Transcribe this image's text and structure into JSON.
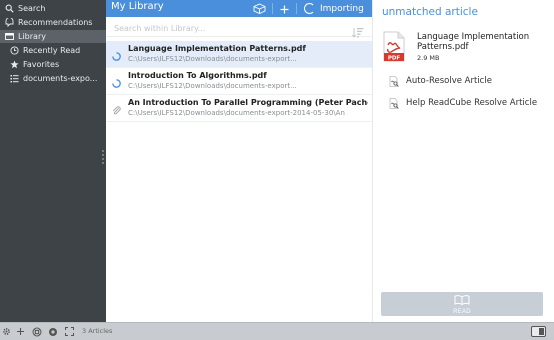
{
  "sidebar": {
    "items": [
      {
        "label": "Search",
        "icon": "search-icon"
      },
      {
        "label": "Recommendations",
        "icon": "recommendations-icon"
      },
      {
        "label": "Library",
        "icon": "library-icon",
        "active": true
      },
      {
        "label": "Recently Read",
        "icon": "clock-icon"
      },
      {
        "label": "Favorites",
        "icon": "star-icon"
      },
      {
        "label": "documents-expo...",
        "icon": "list-icon"
      }
    ]
  },
  "header": {
    "title": "My Library",
    "import_label": "Importing"
  },
  "search": {
    "placeholder": "Search within Library..."
  },
  "articles": [
    {
      "title": "Language Implementation Patterns.pdf",
      "path": "C:\\Users\\ILFS12\\Downloads\\documents-export...",
      "status": "loading",
      "selected": true
    },
    {
      "title": "Introduction To Algorithms.pdf",
      "path": "C:\\Users\\ILFS12\\Downloads\\documents-export...",
      "status": "loading",
      "selected": false
    },
    {
      "title": "An Introduction To Parallel Programming (Peter Pachec...",
      "path": "C:\\Users\\ILFS12\\Downloads\\documents-export-2014-05-30\\An ...",
      "status": "attachment",
      "selected": false
    }
  ],
  "detail": {
    "heading": "unmatched article",
    "file_title": "Language Implementation Patterns.pdf",
    "file_size": "2.9 MB",
    "pdf_label": "PDF",
    "actions": [
      {
        "label": "Auto-Resolve Article"
      },
      {
        "label": "Help ReadCube Resolve Article"
      }
    ],
    "read_label": "READ"
  },
  "footer": {
    "count": "3 Articles"
  },
  "colors": {
    "accent": "#4a8fdb",
    "sidebar_bg": "#3e4347",
    "pdf_red": "#d63a2c"
  }
}
